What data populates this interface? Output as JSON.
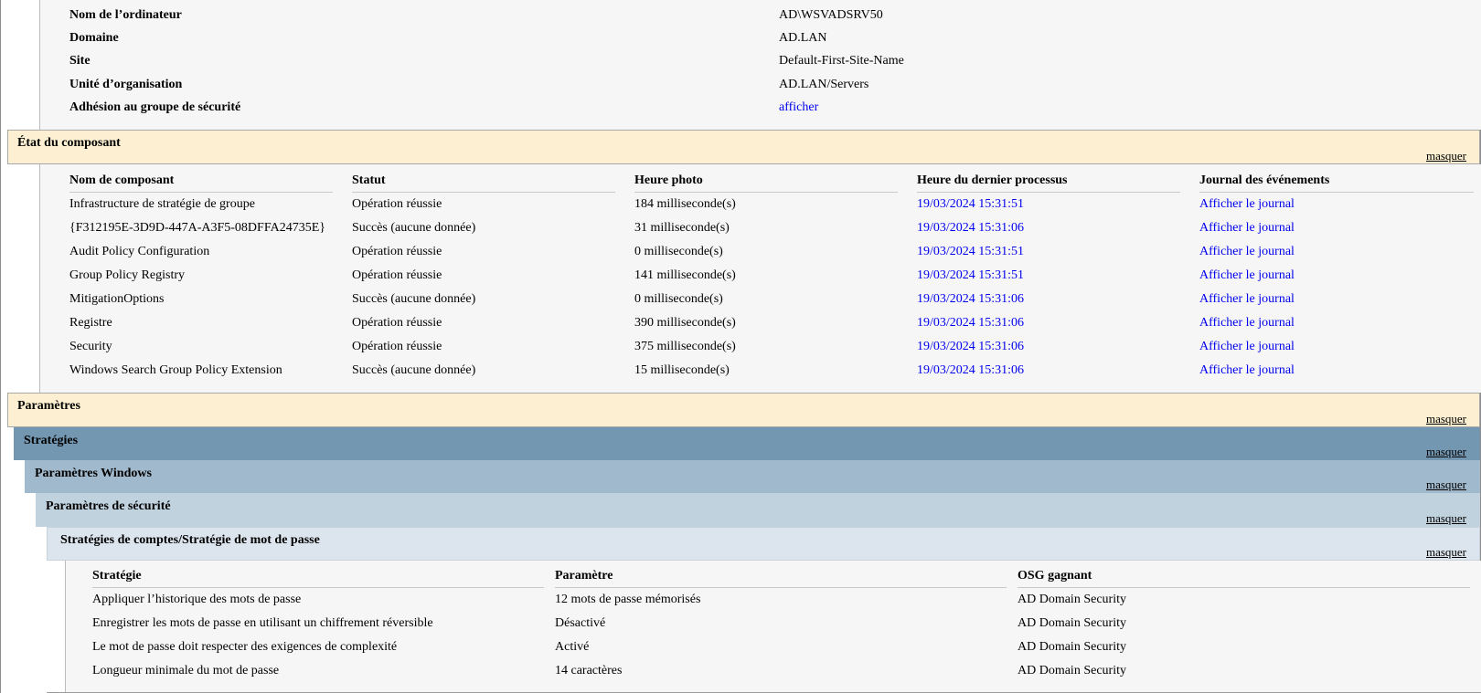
{
  "computer_info": {
    "rows": [
      {
        "label": "Nom de l’ordinateur",
        "value": "AD\\WSVADSRV50"
      },
      {
        "label": "Domaine",
        "value": "AD.LAN"
      },
      {
        "label": "Site",
        "value": "Default-First-Site-Name"
      },
      {
        "label": "Unité d’organisation",
        "value": "AD.LAN/Servers"
      },
      {
        "label": "Adhésion au groupe de sécurité",
        "value": "afficher"
      }
    ]
  },
  "component_section": {
    "title": "État du composant",
    "hide_label": "masquer",
    "headers": [
      "Nom de composant",
      "Statut",
      "Heure photo",
      "Heure du dernier processus",
      "Journal des événements"
    ],
    "rows": [
      [
        "Infrastructure de stratégie de groupe",
        "Opération réussie",
        "184 milliseconde(s)",
        "19/03/2024 15:31:51",
        "Afficher le journal"
      ],
      [
        "{F312195E-3D9D-447A-A3F5-08DFFA24735E}",
        "Succès (aucune donnée)",
        "31 milliseconde(s)",
        "19/03/2024 15:31:06",
        "Afficher le journal"
      ],
      [
        "Audit Policy Configuration",
        "Opération réussie",
        "0 milliseconde(s)",
        "19/03/2024 15:31:51",
        "Afficher le journal"
      ],
      [
        "Group Policy Registry",
        "Opération réussie",
        "141 milliseconde(s)",
        "19/03/2024 15:31:51",
        "Afficher le journal"
      ],
      [
        "MitigationOptions",
        "Succès (aucune donnée)",
        "0 milliseconde(s)",
        "19/03/2024 15:31:06",
        "Afficher le journal"
      ],
      [
        "Registre",
        "Opération réussie",
        "390 milliseconde(s)",
        "19/03/2024 15:31:06",
        "Afficher le journal"
      ],
      [
        "Security",
        "Opération réussie",
        "375 milliseconde(s)",
        "19/03/2024 15:31:06",
        "Afficher le journal"
      ],
      [
        "Windows Search Group Policy Extension",
        "Succès (aucune donnée)",
        "15 milliseconde(s)",
        "19/03/2024 15:31:06",
        "Afficher le journal"
      ]
    ]
  },
  "sections": {
    "parametres": {
      "title": "Paramètres",
      "hide_label": "masquer"
    },
    "strategies": {
      "title": "Stratégies",
      "hide_label": "masquer"
    },
    "parametres_windows": {
      "title": "Paramètres Windows",
      "hide_label": "masquer"
    },
    "parametres_securite": {
      "title": "Paramètres de sécurité",
      "hide_label": "masquer"
    },
    "strategies_comptes": {
      "title": "Stratégies de comptes/Stratégie de mot de passe",
      "hide_label": "masquer"
    }
  },
  "policy_table": {
    "headers": [
      "Stratégie",
      "Paramètre",
      "OSG gagnant"
    ],
    "rows": [
      [
        "Appliquer l’historique des mots de passe",
        "12 mots de passe mémorisés",
        "AD Domain Security"
      ],
      [
        "Enregistrer les mots de passe en utilisant un chiffrement réversible",
        "Désactivé",
        "AD Domain Security"
      ],
      [
        "Le mot de passe doit respecter des exigences de complexité",
        "Activé",
        "AD Domain Security"
      ],
      [
        "Longueur minimale du mot de passe",
        "14 caractères",
        "AD Domain Security"
      ]
    ]
  },
  "colors": {
    "section_beige": "#fdf0d2",
    "level1": "#7396b1",
    "level2": "#a1b9cc",
    "level3": "#c0d2de",
    "level4": "#dce5ed",
    "link": "#0000ee"
  }
}
